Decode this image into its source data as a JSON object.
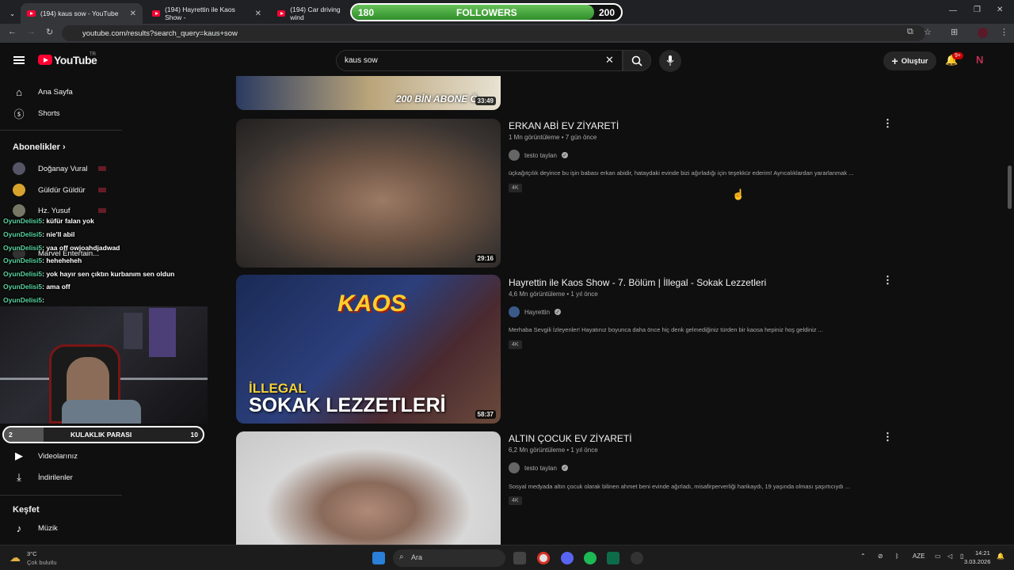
{
  "tabs": [
    {
      "label": "(194) kaus sow - YouTube",
      "active": true
    },
    {
      "label": "(194) Hayrettin ile Kaos Show -",
      "active": false
    },
    {
      "label": "(194) Car driving wind",
      "active": false
    }
  ],
  "address": {
    "url": "youtube.com/results?search_query=kaus+sow"
  },
  "followers": {
    "current": "180",
    "label": "FOLLOWERS",
    "goal": "200",
    "progress": 0.9
  },
  "header": {
    "logo": "YouTube",
    "region": "TR",
    "search_value": "kaus sow",
    "create_label": "Oluştur",
    "notif_badge": "9+"
  },
  "sidebar": {
    "home": "Ana Sayfa",
    "shorts": "Shorts",
    "subs_title": "Abonelikler",
    "channels": [
      "Doğanay Vural",
      "Güldür Güldür",
      "Hz. Yusuf",
      "Marvel Entertain..."
    ],
    "videolar": "Videolarınız",
    "indirilenler": "İndirilenler",
    "kesfet": "Keşfet",
    "muzik": "Müzik"
  },
  "chat": [
    {
      "user": "OyunDelisi5",
      "msg": ": küfür falan yok"
    },
    {
      "user": "OyunDelisi5",
      "msg": ": nie'll abil"
    },
    {
      "user": "OyunDelisi5",
      "msg": ": yaa off owjoahdjadwad"
    },
    {
      "user": "OyunDelisi5",
      "msg": ": heheheheh"
    },
    {
      "user": "OyunDelisi5",
      "msg": ": yok hayır sen çıktın kurbanım sen oldun"
    },
    {
      "user": "OyunDelisi5",
      "msg": ": ama off"
    },
    {
      "user": "OyunDelisi5",
      "msg": ":"
    }
  ],
  "kulaklik": {
    "left": "2",
    "label": "KULAKLIK PARASI",
    "right": "10",
    "progress": 0.2
  },
  "results": [
    {
      "top_duration": "33:49",
      "thumb_caption": "200 BİN ABONE Ö"
    },
    {
      "title": "ERKAN ABİ EV ZİYARETİ",
      "meta": "1 Mn görüntüleme • 7 gün önce",
      "channel": "testo taylan",
      "desc": "üçkağıtçılık deyince bu işin babası erkan abidir, hataydaki evinde bizi ağırladığı için teşekkür ederim! Ayrıcalıklardan yararlanmak ...",
      "tag": "4K",
      "duration": "29:16"
    },
    {
      "title": "Hayrettin ile Kaos Show - 7. Bölüm | İllegal - Sokak Lezzetleri",
      "meta": "4,6 Mn görüntüleme • 1 yıl önce",
      "channel": "Hayrettin",
      "desc": "Merhaba Sevgili İzleyenler! Hayatınız boyunca daha önce hiç denk gelmediğiniz türden bir kaosa hepiniz hoş geldiniz ...",
      "tag": "4K",
      "duration": "58:37",
      "thumb_line1": "İLLEGAL",
      "thumb_line2": "SOKAK LEZZETLERİ",
      "thumb_logo": "KAOS"
    },
    {
      "title": "ALTIN ÇOCUK EV ZİYARETİ",
      "meta": "6,2 Mn görüntüleme • 1 yıl önce",
      "channel": "testo taylan",
      "desc": "Sosyal medyada altın çocuk olarak bilinen ahmet beni evinde ağırladı, misafirperverliği harikaydı, 19 yaşında olması şaşırtıcıydı ...",
      "tag": "4K"
    }
  ],
  "taskbar": {
    "weather_temp": "3°C",
    "weather_desc": "Çok bulutlu",
    "search": "Ara",
    "lang": "AZE",
    "time": "14:21",
    "date": "3.03.2026"
  }
}
